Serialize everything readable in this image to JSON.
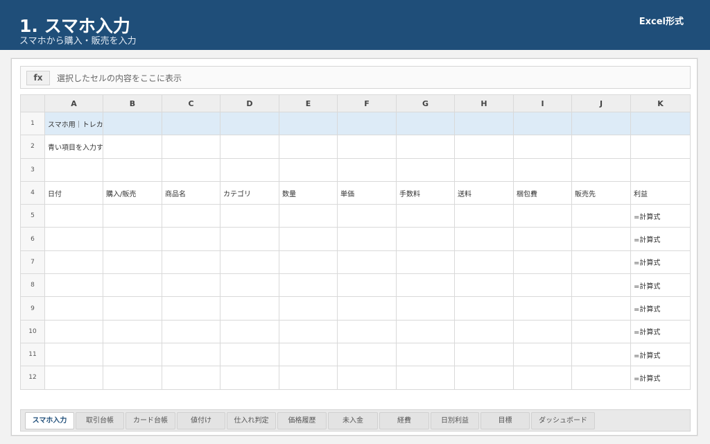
{
  "header": {
    "title": "1. スマホ入力",
    "subtitle": "スマホから購入・販売を入力",
    "format_label": "Excel形式"
  },
  "formula_bar": {
    "fx_label": "fx",
    "text": "選択したセルの内容をここに表示"
  },
  "grid": {
    "columns": [
      "A",
      "B",
      "C",
      "D",
      "E",
      "F",
      "G",
      "H",
      "I",
      "J",
      "K"
    ],
    "rows": [
      {
        "num": "1",
        "cells": [
          "スマホ用｜トレカ売",
          "",
          "",
          "",
          "",
          "",
          "",
          "",
          "",
          "",
          ""
        ]
      },
      {
        "num": "2",
        "cells": [
          "青い項目を入力する",
          "",
          "",
          "",
          "",
          "",
          "",
          "",
          "",
          "",
          ""
        ]
      },
      {
        "num": "3",
        "cells": [
          "",
          "",
          "",
          "",
          "",
          "",
          "",
          "",
          "",
          "",
          ""
        ]
      },
      {
        "num": "4",
        "cells": [
          "日付",
          "購入/販売",
          "商品名",
          "カテゴリ",
          "数量",
          "単価",
          "手数料",
          "送料",
          "梱包費",
          "販売先",
          "利益"
        ]
      },
      {
        "num": "5",
        "cells": [
          "",
          "",
          "",
          "",
          "",
          "",
          "",
          "",
          "",
          "",
          "=計算式"
        ]
      },
      {
        "num": "6",
        "cells": [
          "",
          "",
          "",
          "",
          "",
          "",
          "",
          "",
          "",
          "",
          "=計算式"
        ]
      },
      {
        "num": "7",
        "cells": [
          "",
          "",
          "",
          "",
          "",
          "",
          "",
          "",
          "",
          "",
          "=計算式"
        ]
      },
      {
        "num": "8",
        "cells": [
          "",
          "",
          "",
          "",
          "",
          "",
          "",
          "",
          "",
          "",
          "=計算式"
        ]
      },
      {
        "num": "9",
        "cells": [
          "",
          "",
          "",
          "",
          "",
          "",
          "",
          "",
          "",
          "",
          "=計算式"
        ]
      },
      {
        "num": "10",
        "cells": [
          "",
          "",
          "",
          "",
          "",
          "",
          "",
          "",
          "",
          "",
          "=計算式"
        ]
      },
      {
        "num": "11",
        "cells": [
          "",
          "",
          "",
          "",
          "",
          "",
          "",
          "",
          "",
          "",
          "=計算式"
        ]
      },
      {
        "num": "12",
        "cells": [
          "",
          "",
          "",
          "",
          "",
          "",
          "",
          "",
          "",
          "",
          "=計算式"
        ]
      }
    ]
  },
  "sheet_tabs": [
    {
      "label": "スマホ入力",
      "active": true
    },
    {
      "label": "取引台帳",
      "active": false
    },
    {
      "label": "カード台帳",
      "active": false
    },
    {
      "label": "値付け",
      "active": false
    },
    {
      "label": "仕入れ判定",
      "active": false
    },
    {
      "label": "価格履歴",
      "active": false
    },
    {
      "label": "未入金",
      "active": false
    },
    {
      "label": "経費",
      "active": false
    },
    {
      "label": "日別利益",
      "active": false
    },
    {
      "label": "目標",
      "active": false
    },
    {
      "label": "ダッシュボード",
      "active": false
    }
  ],
  "colors": {
    "header_bg": "#1f4e79",
    "input_row_bg": "#ddebf7",
    "active_tab_text": "#1f4e79"
  }
}
